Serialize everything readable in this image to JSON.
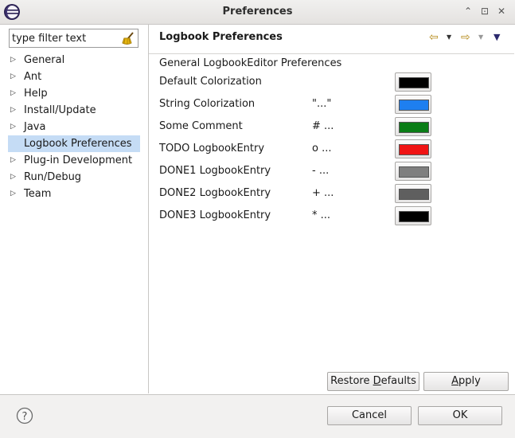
{
  "window": {
    "title": "Preferences"
  },
  "filter": {
    "placeholder": "type filter text"
  },
  "tree": [
    {
      "label": "General",
      "expandable": true
    },
    {
      "label": "Ant",
      "expandable": true
    },
    {
      "label": "Help",
      "expandable": true
    },
    {
      "label": "Install/Update",
      "expandable": true
    },
    {
      "label": "Java",
      "expandable": true
    },
    {
      "label": "Logbook Preferences",
      "expandable": false,
      "selected": true
    },
    {
      "label": "Plug-in Development",
      "expandable": true
    },
    {
      "label": "Run/Debug",
      "expandable": true
    },
    {
      "label": "Team",
      "expandable": true
    }
  ],
  "page": {
    "title": "Logbook Preferences",
    "subtitle": "General LogbookEditor Preferences",
    "rows": [
      {
        "name": "Default Colorization",
        "sample": "",
        "color": "#000000"
      },
      {
        "name": "String Colorization",
        "sample": "\"...\"",
        "color": "#1e7ff0"
      },
      {
        "name": "Some Comment",
        "sample": "# ...",
        "color": "#0a7d16"
      },
      {
        "name": "TODO LogbookEntry",
        "sample": "o ...",
        "color": "#f01414"
      },
      {
        "name": "DONE1 LogbookEntry",
        "sample": "- ...",
        "color": "#7f7f7f"
      },
      {
        "name": "DONE2 LogbookEntry",
        "sample": "+ ...",
        "color": "#5f5f5f"
      },
      {
        "name": "DONE3 LogbookEntry",
        "sample": "* ...",
        "color": "#000000"
      }
    ],
    "restore_prefix": "Restore ",
    "restore_mnemonic": "D",
    "restore_suffix": "efaults",
    "apply_mnemonic": "A",
    "apply_suffix": "pply"
  },
  "footer": {
    "cancel": "Cancel",
    "ok": "OK"
  }
}
